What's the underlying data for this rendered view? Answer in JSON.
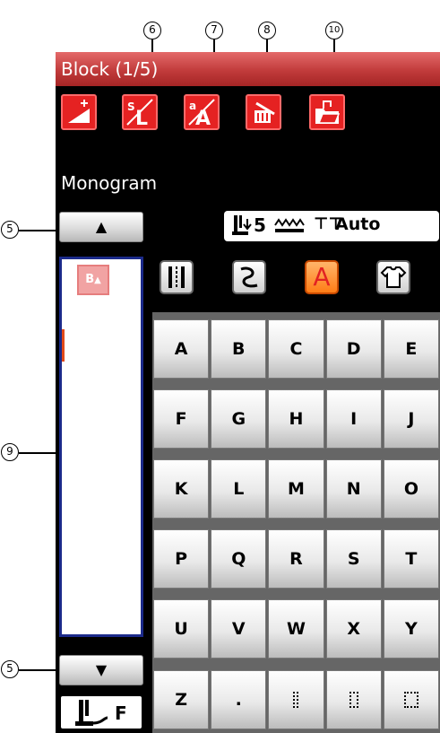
{
  "callouts": {
    "c6": "6",
    "c7": "7",
    "c8": "8",
    "c10": "10",
    "c5_top": "5",
    "c9": "9",
    "c5_bottom": "5"
  },
  "screen": {
    "title": "Block (1/5)",
    "toolbar": [
      {
        "name": "stitch-width-adjust-icon",
        "label": ""
      },
      {
        "name": "letter-size-icon",
        "label": "L",
        "small": "S"
      },
      {
        "name": "case-toggle-icon",
        "label": "A",
        "small": "a"
      },
      {
        "name": "delete-icon",
        "label": ""
      },
      {
        "name": "file-open-icon",
        "label": ""
      }
    ],
    "section_label": "Monogram",
    "status": {
      "presser_foot_number": "5",
      "thread_tension": "Auto"
    },
    "categories": [
      {
        "name": "stitch-category-utility",
        "glyph": ""
      },
      {
        "name": "stitch-category-decorative",
        "glyph": ""
      },
      {
        "name": "stitch-category-monogram",
        "glyph": "A",
        "active": true
      },
      {
        "name": "stitch-category-shirt",
        "glyph": ""
      }
    ],
    "list_block_label": "B",
    "keys": [
      [
        "A",
        "B",
        "C",
        "D",
        "E"
      ],
      [
        "F",
        "G",
        "H",
        "I",
        "J"
      ],
      [
        "K",
        "L",
        "M",
        "N",
        "O"
      ],
      [
        "P",
        "Q",
        "R",
        "S",
        "T"
      ],
      [
        "U",
        "V",
        "W",
        "X",
        "Y"
      ],
      [
        "Z",
        ".",
        "",
        "",
        ""
      ]
    ],
    "presser_foot_letter": "F"
  }
}
